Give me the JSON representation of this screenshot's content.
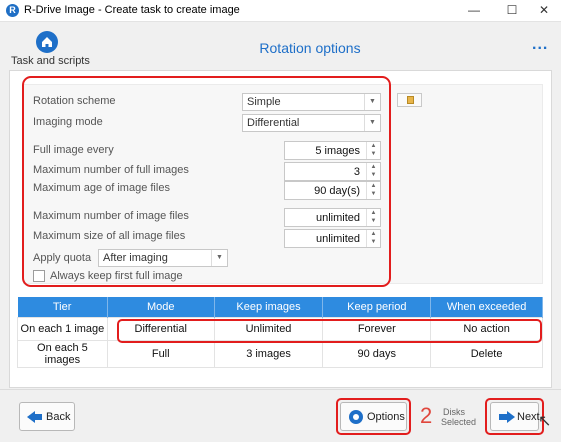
{
  "window": {
    "app_icon": "R",
    "title": "R-Drive Image - Create task to create image",
    "controls": {
      "minimize": "—",
      "maximize": "☐",
      "close": "✕"
    }
  },
  "header": {
    "home_label": "Task and scripts",
    "page_title": "Rotation options",
    "more": "..."
  },
  "settings": {
    "rotation_scheme": {
      "label": "Rotation scheme",
      "value": "Simple"
    },
    "imaging_mode": {
      "label": "Imaging mode",
      "value": "Differential"
    },
    "full_image_every": {
      "label": "Full image every",
      "value": "5 images"
    },
    "max_full_images": {
      "label": "Maximum number of full images",
      "value": "3"
    },
    "max_age": {
      "label": "Maximum age of image files",
      "value": "90 day(s)"
    },
    "max_image_files": {
      "label": "Maximum number of image files",
      "value": "unlimited"
    },
    "max_total_size": {
      "label": "Maximum size of all image files",
      "value": "unlimited"
    },
    "apply_quota": {
      "label": "Apply quota",
      "value": "After imaging"
    },
    "always_keep_first": {
      "label": "Always keep first full image",
      "checked": false
    }
  },
  "table": {
    "columns": [
      "Tier",
      "Mode",
      "Keep images",
      "Keep period",
      "When exceeded"
    ],
    "rows": [
      [
        "On each 1 image",
        "Differential",
        "Unlimited",
        "Forever",
        "No action"
      ],
      [
        "On each 5 images",
        "Full",
        "3 images",
        "90 days",
        "Delete"
      ]
    ]
  },
  "footer": {
    "back_label": "Back",
    "options_label": "Options",
    "disks_count": "2",
    "disks_line1": "Disks",
    "disks_line2": "Selected",
    "next_label": "Next"
  },
  "colors": {
    "accent": "#1e6fc8",
    "highlight": "#e21d1d",
    "table_header": "#2e8be0"
  }
}
